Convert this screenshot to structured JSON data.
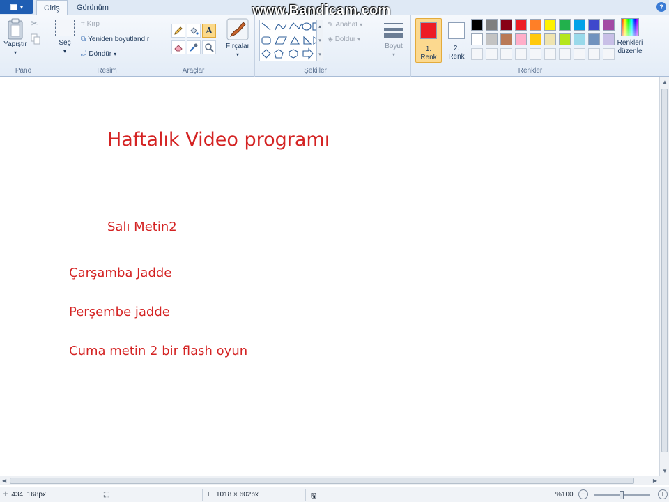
{
  "tabs": [
    {
      "label": "Giriş",
      "active": true
    },
    {
      "label": "Görünüm",
      "active": false
    }
  ],
  "watermark": "www.Bandicam.com",
  "help_glyph": "?",
  "ribbon": {
    "pano": {
      "label": "Pano",
      "paste_label": "Yapıştır"
    },
    "resim": {
      "label": "Resim",
      "select_label": "Seç",
      "crop_label": "Kırp",
      "resize_label": "Yeniden boyutlandır",
      "rotate_label": "Döndür"
    },
    "araclar": {
      "label": "Araçlar",
      "text_tool_glyph": "A"
    },
    "fircalar": {
      "label": "Fırçalar"
    },
    "sekiller": {
      "label": "Şekiller",
      "outline_label": "Anahat",
      "fill_label": "Doldur"
    },
    "boyut": {
      "label": "Boyut"
    },
    "renkler": {
      "label": "Renkler",
      "color1_label": "1. Renk",
      "color1_line1": "1.",
      "color1_line2": "Renk",
      "color2_line1": "2.",
      "color2_line2": "Renk",
      "color1_value": "#ed1c24",
      "color2_value": "#ffffff",
      "edit_label_line1": "Renkleri",
      "edit_label_line2": "düzenle",
      "palette_row1": [
        "#000000",
        "#7f7f7f",
        "#880015",
        "#ed1c24",
        "#ff7f27",
        "#fff200",
        "#22b14c",
        "#00a2e8",
        "#3f48cc",
        "#a349a4"
      ],
      "palette_row2": [
        "#ffffff",
        "#c3c3c3",
        "#b97a57",
        "#ffaec9",
        "#ffc90e",
        "#efe4b0",
        "#b5e61d",
        "#99d9ea",
        "#7092be",
        "#c8bfe7"
      ]
    }
  },
  "canvas": {
    "text_color": "#d42323",
    "lines": [
      {
        "text": "Haftalık Video programı"
      },
      {
        "text": "Salı Metin2"
      },
      {
        "text": "Çarşamba Jadde"
      },
      {
        "text": "Perşembe jadde"
      },
      {
        "text": "Cuma metin 2 bir flash oyun"
      }
    ]
  },
  "statusbar": {
    "cursor_pos": "434, 168px",
    "image_size": "1018 × 602px",
    "zoom": "%100"
  }
}
